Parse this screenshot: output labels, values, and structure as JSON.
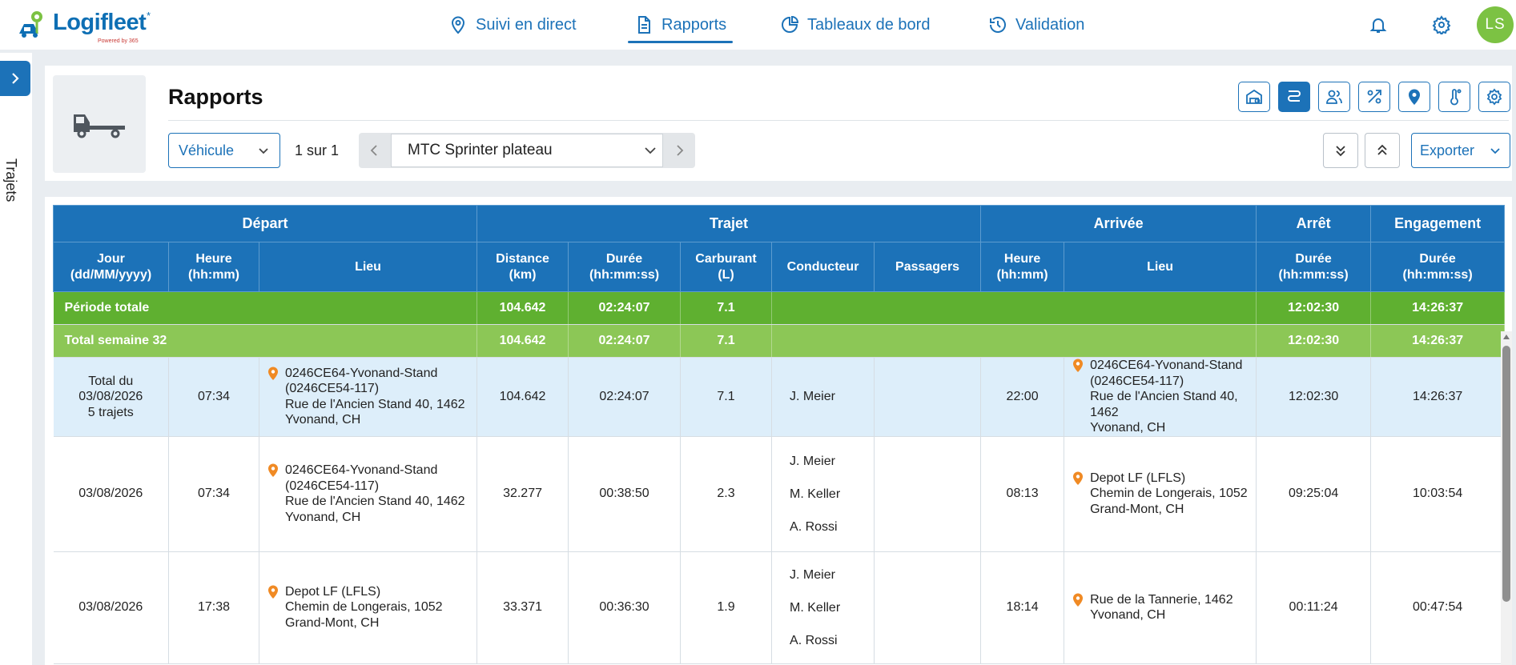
{
  "app": {
    "logo_text": "Logifleet",
    "logo_mark": "*",
    "logo_sub": "Powered by 365",
    "brand_color": "#1c72b8",
    "accent_green": "#5fb030"
  },
  "nav": {
    "items": [
      {
        "label": "Suivi en direct",
        "icon": "location-pin-icon"
      },
      {
        "label": "Rapports",
        "icon": "document-icon",
        "active": true
      },
      {
        "label": "Tableaux de bord",
        "icon": "dashboard-pie-icon"
      },
      {
        "label": "Validation",
        "icon": "history-icon"
      }
    ]
  },
  "user": {
    "initials": "LS"
  },
  "sidebar": {
    "tab_label": "Trajets"
  },
  "header": {
    "title": "Rapports",
    "vehicle_filter": "Véhicule",
    "pager": "1 sur 1",
    "vehicle_selected": "MTC Sprinter plateau",
    "export_label": "Exporter",
    "report_icons": [
      "garage-icon",
      "route-icon",
      "drivers-icon",
      "percent-icon",
      "map-pin-icon",
      "thermometer-icon",
      "settings-icon"
    ],
    "active_report_icon": "route-icon"
  },
  "table": {
    "groups": [
      "Départ",
      "Trajet",
      "Arrivée",
      "Arrêt",
      "Engagement"
    ],
    "columns": {
      "dep_day": [
        "Jour",
        "(dd/MM/yyyy)"
      ],
      "dep_time": [
        "Heure",
        "(hh:mm)"
      ],
      "dep_place": "Lieu",
      "distance": [
        "Distance",
        "(km)"
      ],
      "duration": [
        "Durée",
        "(hh:mm:ss)"
      ],
      "fuel": [
        "Carburant",
        "(L)"
      ],
      "driver": "Conducteur",
      "passengers": "Passagers",
      "arr_time": [
        "Heure",
        "(hh:mm)"
      ],
      "arr_place": "Lieu",
      "stop_duration": [
        "Durée",
        "(hh:mm:ss)"
      ],
      "engagement_duration": [
        "Durée",
        "(hh:mm:ss)"
      ]
    },
    "summary_rows": [
      {
        "label": "Période totale",
        "distance": "104.642",
        "duration": "02:24:07",
        "fuel": "7.1",
        "stop": "12:02:30",
        "engagement": "14:26:37"
      },
      {
        "label": "Total semaine 32",
        "distance": "104.642",
        "duration": "02:24:07",
        "fuel": "7.1",
        "stop": "12:02:30",
        "engagement": "14:26:37"
      }
    ],
    "day_row": {
      "day_lines": [
        "Total du",
        "03/08/2026",
        "5 trajets"
      ],
      "dep_time": "07:34",
      "dep_place": [
        "0246CE64-Yvonand-Stand",
        "(0246CE54-117)",
        "Rue de l'Ancien Stand 40, 1462",
        "Yvonand, CH"
      ],
      "distance": "104.642",
      "duration": "02:24:07",
      "fuel": "7.1",
      "driver": "J. Meier",
      "arr_time": "22:00",
      "arr_place": [
        "0246CE64-Yvonand-Stand",
        "(0246CE54-117)",
        "Rue de l'Ancien Stand 40, 1462",
        "Yvonand, CH"
      ],
      "stop": "12:02:30",
      "engagement": "14:26:37"
    },
    "trips": [
      {
        "day": "03/08/2026",
        "dep_time": "07:34",
        "dep_place": [
          "0246CE64-Yvonand-Stand",
          "(0246CE54-117)",
          "Rue de l'Ancien Stand 40, 1462",
          "Yvonand, CH"
        ],
        "distance": "32.277",
        "duration": "00:38:50",
        "fuel": "2.3",
        "drivers": [
          "J. Meier",
          "M. Keller",
          "A. Rossi"
        ],
        "arr_time": "08:13",
        "arr_place": [
          "Depot LF (LFLS)",
          "Chemin de Longerais, 1052",
          "Grand-Mont, CH"
        ],
        "stop": "09:25:04",
        "engagement": "10:03:54"
      },
      {
        "day": "03/08/2026",
        "dep_time": "17:38",
        "dep_place": [
          "Depot LF (LFLS)",
          "Chemin de Longerais, 1052",
          "Grand-Mont, CH"
        ],
        "distance": "33.371",
        "duration": "00:36:30",
        "fuel": "1.9",
        "drivers": [
          "J. Meier",
          "M. Keller",
          "A. Rossi"
        ],
        "arr_time": "18:14",
        "arr_place": [
          "Rue de la Tannerie, 1462",
          "Yvonand, CH"
        ],
        "stop": "00:11:24",
        "engagement": "00:47:54"
      }
    ]
  }
}
